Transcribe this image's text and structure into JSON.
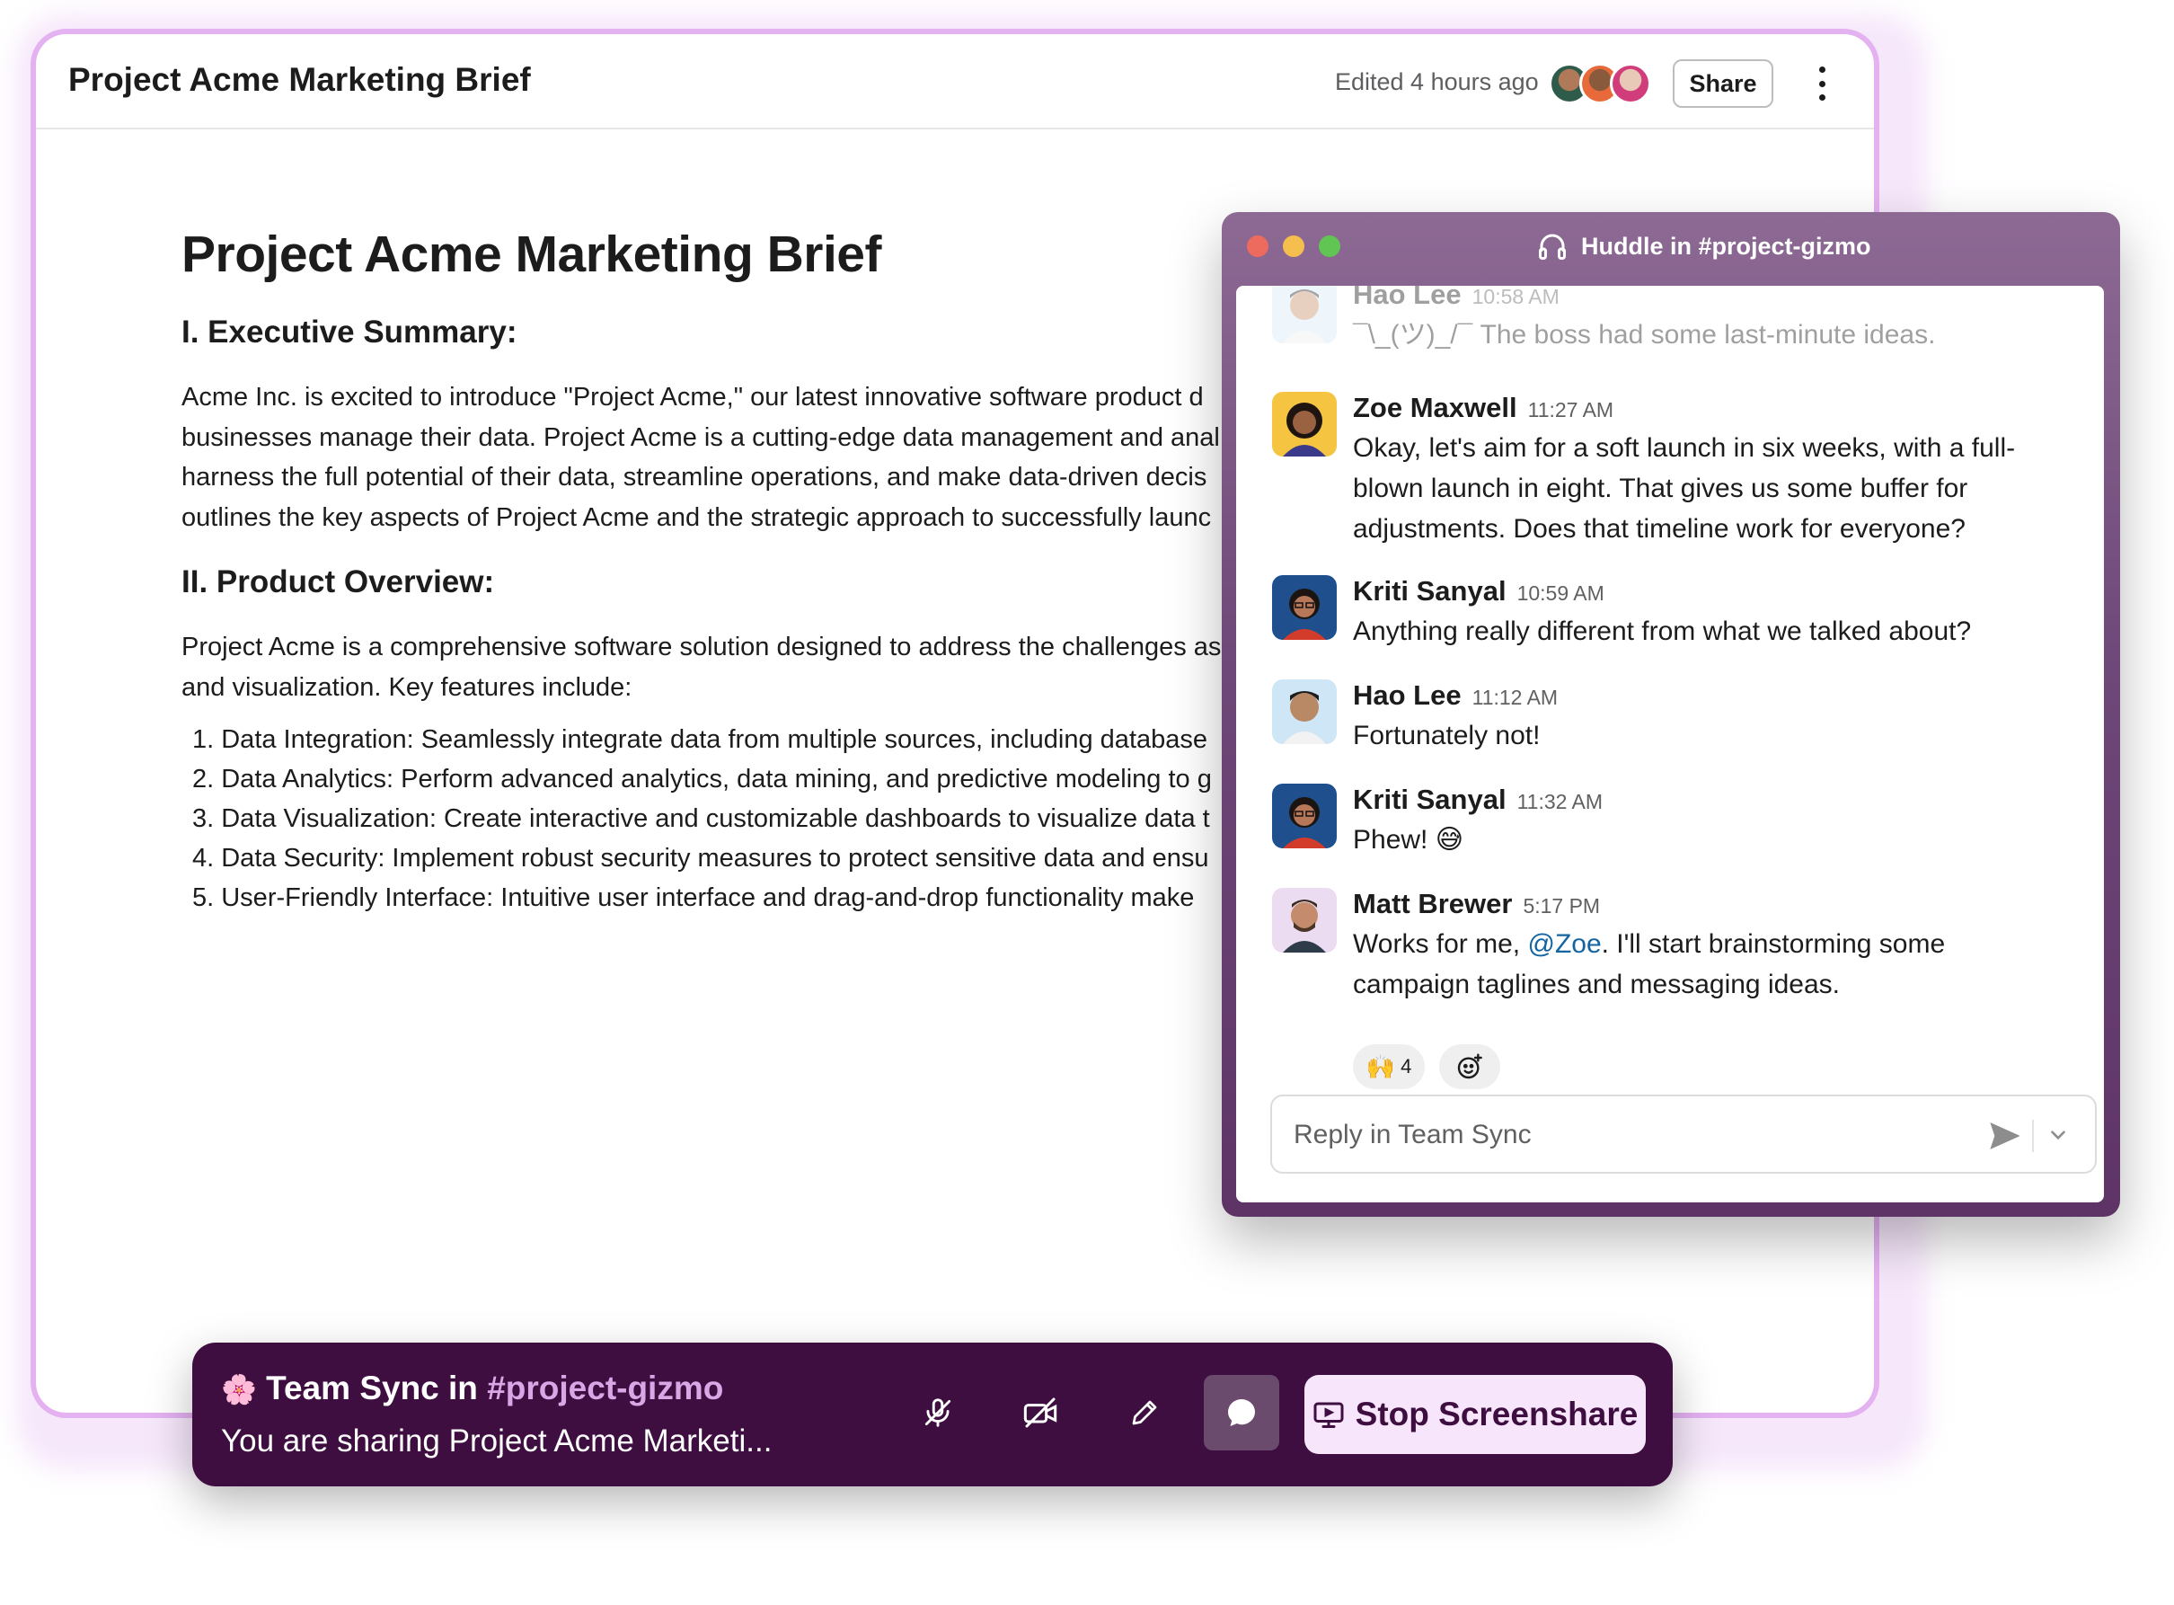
{
  "document": {
    "header_title": "Project Acme Marketing Brief",
    "edited": "Edited 4 hours ago",
    "share_label": "Share",
    "heading": "Project Acme Marketing Brief",
    "section1_title": "I. Executive Summary:",
    "section1_lines": [
      "Acme Inc. is excited to introduce \"Project Acme,\" our latest innovative software product d",
      "businesses manage their data. Project Acme is a cutting-edge data management and anal",
      "harness the full potential of their data, streamline operations, and make data-driven decis",
      "outlines the key aspects of Project Acme and the strategic approach to successfully launc"
    ],
    "section2_title": "II. Product Overview:",
    "section2_lines": [
      "Project Acme is a comprehensive software solution designed to address the challenges as",
      "and visualization. Key features include:"
    ],
    "features": [
      "1. Data Integration: Seamlessly integrate data from multiple sources, including database",
      "2. Data Analytics: Perform advanced analytics, data mining, and predictive modeling to g",
      "3. Data Visualization: Create interactive and customizable dashboards to visualize data t",
      "4. Data Security: Implement robust security measures to protect sensitive data and ensu",
      "5. User-Friendly Interface: Intuitive user interface and drag-and-drop functionality make"
    ]
  },
  "huddle": {
    "title": "Huddle in #project-gizmo",
    "messages": [
      {
        "name": "Hao Lee",
        "time": "10:58 AM",
        "text": "¯\\_(ツ)_/¯ The boss had some last-minute ideas."
      },
      {
        "name": "Zoe Maxwell",
        "time": "11:27 AM",
        "text": "Okay, let's aim for a soft launch in six weeks, with a full-blown launch in eight. That gives us some buffer for adjustments. Does that timeline work for everyone?"
      },
      {
        "name": "Kriti Sanyal",
        "time": "10:59 AM",
        "text": "Anything really different from what we talked about?"
      },
      {
        "name": "Hao Lee",
        "time": "11:12 AM",
        "text": "Fortunately not!"
      },
      {
        "name": "Kriti Sanyal",
        "time": "11:32 AM",
        "text": "Phew! 😅"
      },
      {
        "name": "Matt Brewer",
        "time": "5:17 PM",
        "text_before": "Works for me, ",
        "mention": "@Zoe",
        "text_after": ". I'll start brainstorming some campaign taglines and messaging ideas."
      }
    ],
    "reaction_emoji": "🙌",
    "reaction_count": "4",
    "reply_placeholder": "Reply in Team Sync"
  },
  "bar": {
    "emoji": "🌸",
    "title_prefix": "Team Sync in ",
    "channel": "#project-gizmo",
    "subtitle": "You are sharing Project Acme Marketi...",
    "stop_label": "Stop Screenshare"
  },
  "colors": {
    "aubergine": "#3f0e40",
    "doc_border": "#e4b1f1",
    "mention": "#1264a3",
    "stop_button_bg": "#f7e6fb"
  }
}
